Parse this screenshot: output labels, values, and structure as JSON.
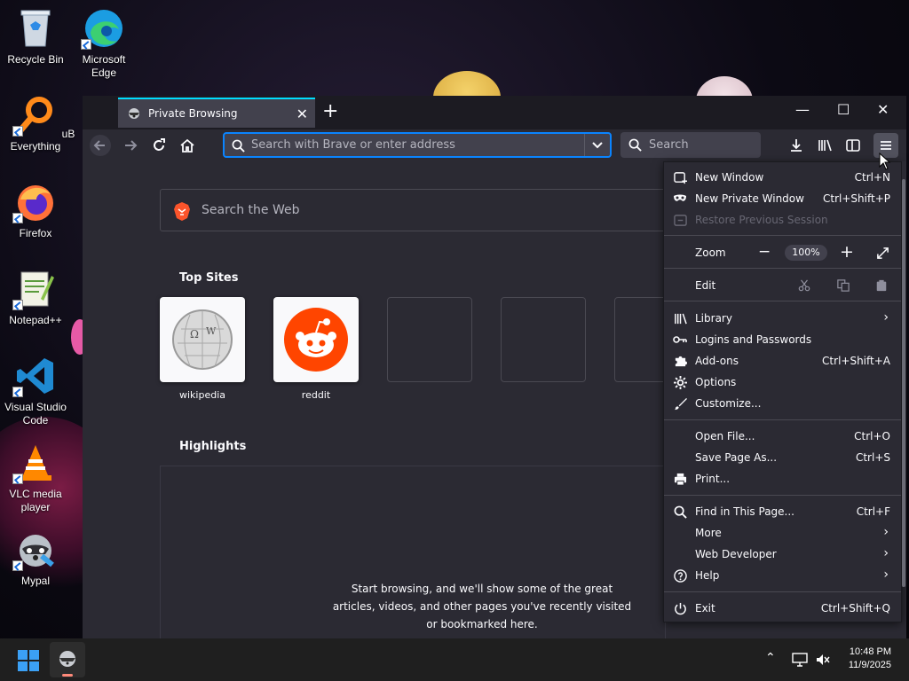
{
  "desktop": {
    "icons": [
      {
        "label": "Recycle Bin"
      },
      {
        "label": "Microsoft Edge"
      },
      {
        "label": "Everything"
      },
      {
        "label": "uB"
      },
      {
        "label": "Firefox"
      },
      {
        "label": "Notepad++"
      },
      {
        "label": "Visual Studio Code"
      },
      {
        "label": "VLC media player"
      },
      {
        "label": "Mypal"
      }
    ]
  },
  "browser": {
    "tab": {
      "title": "Private Browsing",
      "close": "✕"
    },
    "new_tab": "+",
    "window_controls": {
      "minimize": "—",
      "maximize": "☐",
      "close": "✕"
    },
    "urlbar": {
      "placeholder": "Search with Brave or enter address"
    },
    "searchbar": {
      "placeholder": "Search"
    },
    "content": {
      "search_placeholder": "Search the Web",
      "top_sites_title": "Top Sites",
      "top_sites": [
        {
          "label": "wikipedia"
        },
        {
          "label": "reddit"
        },
        {
          "label": ""
        },
        {
          "label": ""
        },
        {
          "label": ""
        }
      ],
      "highlights_title": "Highlights",
      "highlights_message": "Start browsing, and we'll show some of the great articles, videos, and other pages you've recently visited or bookmarked here."
    }
  },
  "menu": {
    "new_window": {
      "label": "New Window",
      "shortcut": "Ctrl+N"
    },
    "new_private_window": {
      "label": "New Private Window",
      "shortcut": "Ctrl+Shift+P"
    },
    "restore_session": {
      "label": "Restore Previous Session"
    },
    "zoom": {
      "label": "Zoom",
      "minus": "−",
      "value": "100%",
      "plus": "+"
    },
    "edit": {
      "label": "Edit"
    },
    "library": {
      "label": "Library"
    },
    "logins": {
      "label": "Logins and Passwords"
    },
    "addons": {
      "label": "Add-ons",
      "shortcut": "Ctrl+Shift+A"
    },
    "options": {
      "label": "Options"
    },
    "customize": {
      "label": "Customize..."
    },
    "open_file": {
      "label": "Open File...",
      "shortcut": "Ctrl+O"
    },
    "save_page": {
      "label": "Save Page As...",
      "shortcut": "Ctrl+S"
    },
    "print": {
      "label": "Print..."
    },
    "find": {
      "label": "Find in This Page...",
      "shortcut": "Ctrl+F"
    },
    "more": {
      "label": "More"
    },
    "web_developer": {
      "label": "Web Developer"
    },
    "help": {
      "label": "Help"
    },
    "exit": {
      "label": "Exit",
      "shortcut": "Ctrl+Shift+Q"
    }
  },
  "taskbar": {
    "time": "10:48 PM",
    "date": "11/9/2025"
  },
  "colors": {
    "accent": "#0a84ff",
    "tab_accent": "#00ddff",
    "menu_bg": "#2b2a33",
    "reddit": "#ff4500",
    "brave": "#fb542b"
  }
}
